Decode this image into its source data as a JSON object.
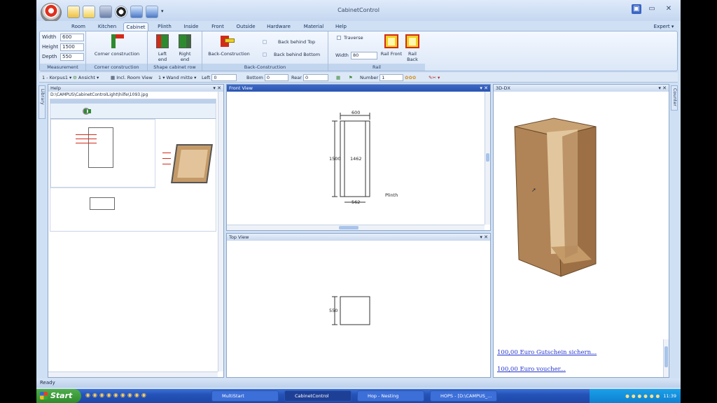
{
  "window": {
    "title": "CabinetControl",
    "expert_label": "Expert"
  },
  "tabs": [
    {
      "label": "Room",
      "active": false
    },
    {
      "label": "Kitchen",
      "active": false
    },
    {
      "label": "Cabinet",
      "active": true
    },
    {
      "label": "Plinth",
      "active": false
    },
    {
      "label": "Inside",
      "active": false
    },
    {
      "label": "Front",
      "active": false
    },
    {
      "label": "Outside",
      "active": false
    },
    {
      "label": "Hardware",
      "active": false
    },
    {
      "label": "Material",
      "active": false
    },
    {
      "label": "Help",
      "active": false
    }
  ],
  "ribbon": {
    "measurement": {
      "label": "Measurement",
      "width_label": "Width",
      "width_value": "600",
      "height_label": "Height",
      "height_value": "1500",
      "depth_label": "Depth",
      "depth_value": "550"
    },
    "corner": {
      "label": "Corner construction",
      "button_label": "Corner construction"
    },
    "shape": {
      "label": "Shape cabinet row",
      "left_end": "Left end",
      "right_end": "Right end"
    },
    "back": {
      "label": "Back-Construction",
      "button_label": "Back-Construction",
      "behind_top": "Back behind Top",
      "behind_bottom": "Back behind Bottom"
    },
    "rail": {
      "label": "Rail",
      "traverse": "Traverse",
      "width_label": "Width",
      "width_value": "80",
      "front": "Rail Front",
      "back": "Rail Back"
    }
  },
  "toolbar": {
    "korpus": "1 - Korpus1",
    "ansicht": "Ansicht",
    "room_view": "Incl. Room View",
    "wand_num": "1",
    "wand": "Wand mitte",
    "left": "Left",
    "left_value": "0",
    "bottom": "Bottom",
    "bottom_value": "0",
    "rear": "Rear",
    "rear_value": "0",
    "number": "Number",
    "number_value": "1"
  },
  "side_left": "Library",
  "side_right": "Counter",
  "help_pane": {
    "title": "Help",
    "path": "D:\\CAMPUS\\CabinetControlLight\\hilfe\\1093.jpg"
  },
  "front_view": {
    "title": "Front View",
    "dim_width": "600",
    "dim_height": "1500",
    "dim_inner": "1462",
    "dim_bottom": "562",
    "plinth": "Plinth"
  },
  "top_view": {
    "title": "Top View",
    "dim_depth": "550"
  },
  "view_3d": {
    "title": "3D-DX",
    "link1": "100,00 Euro Gutschein sichern...",
    "link2": "100,00 Euro voucher..."
  },
  "status": "Ready",
  "taskbar": {
    "start": "Start",
    "items": [
      {
        "label": "MultiStart",
        "active": false
      },
      {
        "label": "CabinetControl",
        "active": true
      },
      {
        "label": "Hop - Nesting",
        "active": false
      },
      {
        "label": "HOPS - [D:\\CAMPUS_...",
        "active": false
      }
    ],
    "clock": "11:39"
  },
  "colors": {
    "ribbon_bg": "#dbe7f7",
    "taskbar": "#2453b8",
    "wood": "#b88e62",
    "start": "#3b9a38"
  }
}
